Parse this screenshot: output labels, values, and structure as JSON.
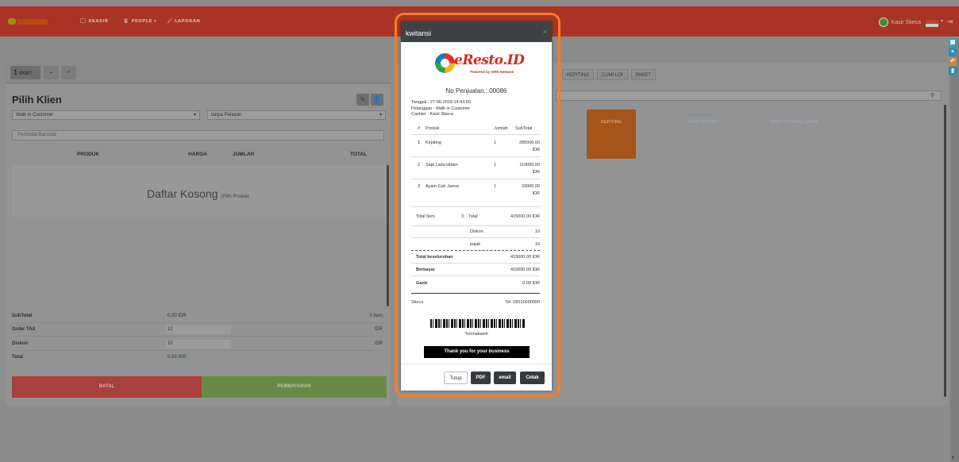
{
  "topbar": {
    "nav": [
      {
        "icon": "cart-icon",
        "glyph": "☐",
        "label": "EKASIR"
      },
      {
        "icon": "people-icon",
        "glyph": "♛",
        "label": "PEOPLE ▾"
      },
      {
        "icon": "chart-icon",
        "glyph": "⟋",
        "label": "LAPORAN"
      }
    ],
    "user_name": "Kasir Skeca",
    "user_caret": "▾"
  },
  "left": {
    "tab_number": "1",
    "tab_label": "SKBT",
    "title": "Pilih Klien",
    "customer_select": "Walk in Customer",
    "waiter_select": "tanpa Pelayan",
    "barcode_placeholder": "Pemindai Barcode",
    "columns": [
      "PRODUK",
      "HARGA",
      "JUMLAH",
      "TOTAL"
    ],
    "empty_main": "Daftar Kosong",
    "empty_sub": "(Pilih Produk)",
    "summary": [
      {
        "label": "SubTotal",
        "value": "0.00 IDR",
        "right": "0 item"
      },
      {
        "label": "Order TAX",
        "value": "10",
        "right": "IDR"
      },
      {
        "label": "Diskon",
        "value": "10",
        "right": "IDR"
      },
      {
        "label": "Total",
        "value": "0.00 IDR",
        "right": ""
      }
    ],
    "cancel_label": "BATAL",
    "pay_label": "PEMBAYARAN"
  },
  "right": {
    "categories": [
      "KEPITING",
      "CUMI LOI",
      "PAKET"
    ],
    "products": [
      {
        "name": "KEPITING",
        "sub": "",
        "color": "#a5541a"
      },
      {
        "name": "AYAM PENYET",
        "sub": "Ayam penyet",
        "color": "#263340"
      },
      {
        "name": "AYAM GORENG LEMES",
        "sub": "",
        "color": "#263340"
      }
    ]
  },
  "modal": {
    "title": "kwitansi",
    "logo_text": "eResto.ID",
    "logo_tagline": "Powered by GRN Network",
    "sale_no": "No Penjualan.: 00086",
    "date": "Tanggal : 27-06-2018 14:43:50",
    "customer": "Pelanggan : Walk in Customer",
    "cashier": "Cashier : Kasir Skeca",
    "item_headers": [
      "#",
      "Produk",
      "Jumlah",
      "SubTotal"
    ],
    "items": [
      {
        "no": "1",
        "name": "Kepiting",
        "qty": "1",
        "amount": "285000.00",
        "cur": "IDR"
      },
      {
        "no": "2",
        "name": "Sapi Lada Hitam",
        "qty": "1",
        "amount": "110000.00",
        "cur": "IDR"
      },
      {
        "no": "3",
        "name": "Ayam Cah Jamur",
        "qty": "1",
        "amount": "20000.00",
        "cur": "IDR"
      }
    ],
    "total_item_label": "Total Item",
    "total_item_count": "3",
    "total_label": "Total",
    "total_value": "415000.00 IDR",
    "diskon_label": "Diskon",
    "diskon_value": "10",
    "pajak_label": "pajak",
    "pajak_value": "10",
    "grand_label": "Total keseluruhan",
    "grand_value": "415000.00 IDR",
    "paid_label": "Berbayar",
    "paid_value": "415000.00 IDR",
    "change_label": "Ganti",
    "change_value": "0.00 IDR",
    "store": "Skeca",
    "phone": "Tel: 08510000000",
    "thanks_small": "Terimakasih",
    "thanks_banner": "Thank you for your business",
    "buttons": {
      "close": "Tutup",
      "pdf": "PDF",
      "email": "email",
      "print": "Cetak"
    }
  }
}
